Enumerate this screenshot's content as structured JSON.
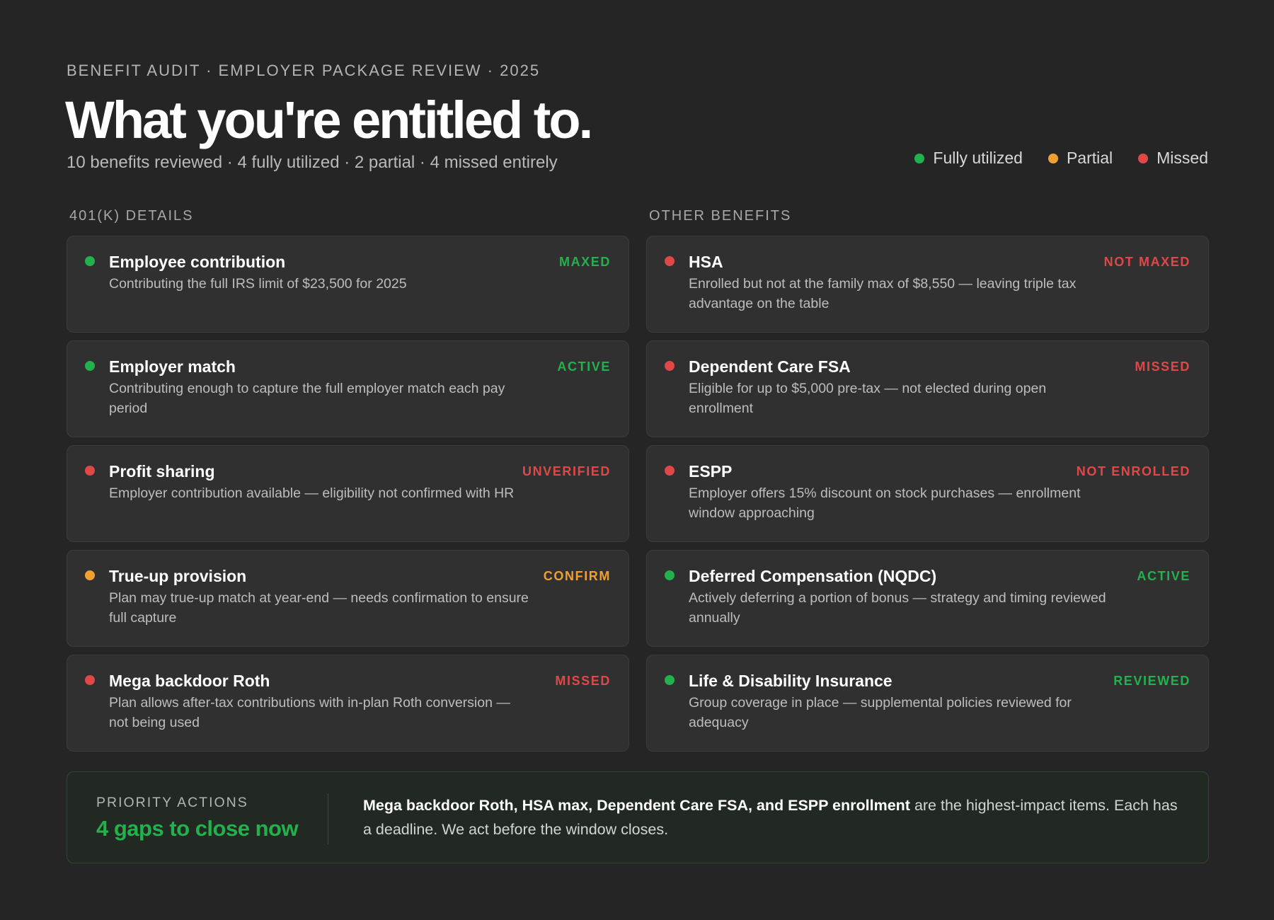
{
  "header": {
    "eyebrow": "BENEFIT AUDIT · EMPLOYER PACKAGE REVIEW · 2025",
    "title": "What you're entitled to.",
    "subtitle": "10 benefits reviewed · 4 fully utilized · 2 partial · 4 missed entirely"
  },
  "legend": [
    {
      "label": "Fully utilized",
      "color": "#22b14c"
    },
    {
      "label": "Partial",
      "color": "#f0a030"
    },
    {
      "label": "Missed",
      "color": "#e04848"
    }
  ],
  "columns": [
    {
      "heading": "401(K) DETAILS",
      "cards": [
        {
          "title": "Employee contribution",
          "desc": "Contributing the full IRS limit of $23,500 for 2025",
          "status": "MAXED",
          "state": "full"
        },
        {
          "title": "Employer match",
          "desc": "Contributing enough to capture the full employer match each pay period",
          "status": "ACTIVE",
          "state": "full"
        },
        {
          "title": "Profit sharing",
          "desc": "Employer contribution available — eligibility not confirmed with HR",
          "status": "UNVERIFIED",
          "state": "missed"
        },
        {
          "title": "True-up provision",
          "desc": "Plan may true-up match at year-end — needs confirmation to ensure full capture",
          "status": "CONFIRM",
          "state": "partial"
        },
        {
          "title": "Mega backdoor Roth",
          "desc": "Plan allows after-tax contributions with in-plan Roth conversion — not being used",
          "status": "MISSED",
          "state": "missed"
        }
      ]
    },
    {
      "heading": "OTHER BENEFITS",
      "cards": [
        {
          "title": "HSA",
          "desc": "Enrolled but not at the family max of $8,550 — leaving triple tax advantage on the table",
          "status": "NOT MAXED",
          "state": "missed"
        },
        {
          "title": "Dependent Care FSA",
          "desc": "Eligible for up to $5,000 pre-tax — not elected during open enrollment",
          "status": "MISSED",
          "state": "missed"
        },
        {
          "title": "ESPP",
          "desc": "Employer offers 15% discount on stock purchases — enrollment window approaching",
          "status": "NOT ENROLLED",
          "state": "missed"
        },
        {
          "title": "Deferred Compensation (NQDC)",
          "desc": "Actively deferring a portion of bonus — strategy and timing reviewed annually",
          "status": "ACTIVE",
          "state": "full"
        },
        {
          "title": "Life & Disability Insurance",
          "desc": "Group coverage in place — supplemental policies reviewed for adequacy",
          "status": "REVIEWED",
          "state": "full"
        }
      ]
    }
  ],
  "state_colors": {
    "full": "#22b14c",
    "partial": "#f0a030",
    "missed": "#e04848"
  },
  "priority": {
    "label": "PRIORITY ACTIONS",
    "headline": "4 gaps to close now",
    "text_bold": "Mega backdoor Roth, HSA max, Dependent Care FSA, and ESPP enrollment",
    "text_rest": " are the highest-impact items. Each has a deadline. We act before the window closes."
  }
}
